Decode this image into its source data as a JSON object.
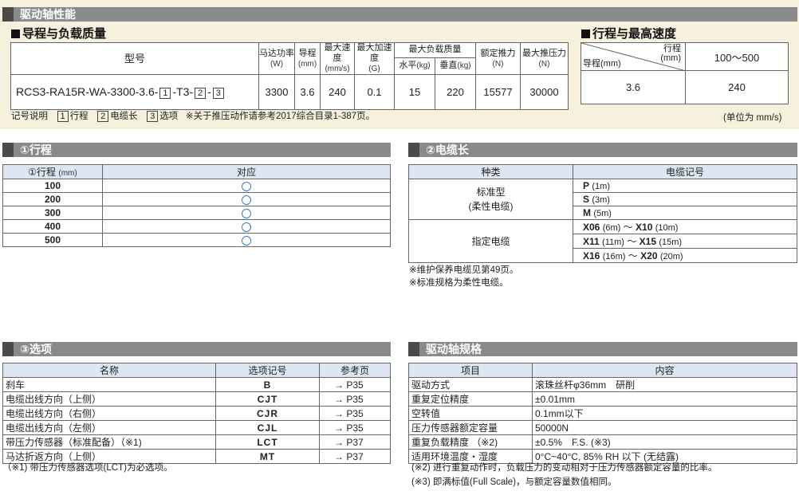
{
  "section_drive": {
    "title": "驱动轴性能"
  },
  "lead_load": {
    "heading": "导程与负载质量",
    "headers": {
      "model": "型号",
      "motor": "马达功率",
      "motor_unit": "(W)",
      "lead": "导程",
      "lead_unit": "(mm)",
      "max_speed": "最大速度",
      "max_speed_unit": "(mm/s)",
      "max_acc": "最大加速度",
      "max_acc_unit": "(G)",
      "max_load": "最大负载质量",
      "horizontal": "水平",
      "horizontal_unit": "(kg)",
      "vertical": "垂直",
      "vertical_unit": "(kg)",
      "rated_thrust": "额定推力",
      "rated_thrust_unit": "(N)",
      "max_thrust": "最大推压力",
      "max_thrust_unit": "(N)"
    },
    "row": {
      "model_prefix": "RCS3-RA15R-WA-3300-3.6-",
      "box1": "1",
      "dash1": "-T3-",
      "box2": "2",
      "dash2": "-",
      "box3": "3",
      "motor": "3300",
      "lead": "3.6",
      "max_speed": "240",
      "max_acc": "0.1",
      "horizontal": "15",
      "vertical": "220",
      "rated_thrust": "15577",
      "max_thrust": "30000"
    }
  },
  "stroke_speed": {
    "heading": "行程与最高速度",
    "stroke_label": "行程",
    "stroke_unit": "(mm)",
    "lead_label": "导程(mm)",
    "range": "100～500",
    "lead": "3.6",
    "speed": "240",
    "unit_note": "(单位为 mm/s)"
  },
  "legend": {
    "label": "记号说明",
    "item1_box": "1",
    "item1": "行程",
    "item2_box": "2",
    "item2": "电缆长",
    "item3_box": "3",
    "item3": "选项",
    "note": "※关于推压动作请参考2017综合目录1-387页。"
  },
  "stroke_table": {
    "title": "①行程",
    "headers": {
      "stroke": "①行程",
      "stroke_unit": "(mm)",
      "support": "对应"
    },
    "rows": [
      "100",
      "200",
      "300",
      "400",
      "500"
    ]
  },
  "cable_table": {
    "title": "②电缆长",
    "headers": {
      "type": "种类",
      "code": "电缆记号"
    },
    "standard": "标准型",
    "standard_sub": "(柔性电缆)",
    "specified": "指定电缆",
    "codes": [
      {
        "a": "P",
        "a_len": "(1m)"
      },
      {
        "a": "S",
        "a_len": "(3m)"
      },
      {
        "a": "M",
        "a_len": "(5m)"
      },
      {
        "a": "X06",
        "a_len": "(6m)",
        "tilde": "～",
        "b": "X10",
        "b_len": "(10m)"
      },
      {
        "a": "X11",
        "a_len": "(11m)",
        "tilde": "～",
        "b": "X15",
        "b_len": "(15m)"
      },
      {
        "a": "X16",
        "a_len": "(16m)",
        "tilde": "～",
        "b": "X20",
        "b_len": "(20m)"
      }
    ],
    "note1": "※维护保养电缆见第49页。",
    "note2": "※标准规格为柔性电缆。"
  },
  "option_table": {
    "title": "③选项",
    "headers": {
      "name": "名称",
      "code": "选项记号",
      "ref": "参考页"
    },
    "rows": [
      {
        "name": "刹车",
        "code": "B",
        "ref": "→ P35"
      },
      {
        "name": "电缆出线方向（上侧）",
        "code": "CJT",
        "ref": "→ P35"
      },
      {
        "name": "电缆出线方向（右侧）",
        "code": "CJR",
        "ref": "→ P35"
      },
      {
        "name": "电缆出线方向（左侧）",
        "code": "CJL",
        "ref": "→ P35"
      },
      {
        "name": "带压力传感器（标准配备）（※1)",
        "code": "LCT",
        "ref": "→ P37"
      },
      {
        "name": "马达折返方向（上侧）",
        "code": "MT",
        "ref": "→ P37"
      }
    ],
    "note": "（※1) 带压力传感器选项(LCT)为必选项。"
  },
  "spec_table": {
    "title": "驱动轴规格",
    "headers": {
      "item": "项目",
      "content": "内容"
    },
    "rows": [
      {
        "item": "驱动方式",
        "content": "滚珠丝杆φ36mm　研削"
      },
      {
        "item": "重复定位精度",
        "content": "±0.01mm"
      },
      {
        "item": "空转值",
        "content": "0.1mm以下"
      },
      {
        "item": "压力传感器额定容量",
        "content": "50000N"
      },
      {
        "item": "重复负载精度 （※2)",
        "content": "±0.5%　F.S. (※3)"
      },
      {
        "item": "适用环境温度・湿度",
        "content": "0°C~40°C, 85% RH 以下 (无结露)"
      }
    ],
    "note1": "(※2) 进行重复动作时，负载压力的变动相对于压力传感器额定容量的比率。",
    "note2": "(※3) 即满标值(Full Scale)，与额定容量数值相同。"
  }
}
